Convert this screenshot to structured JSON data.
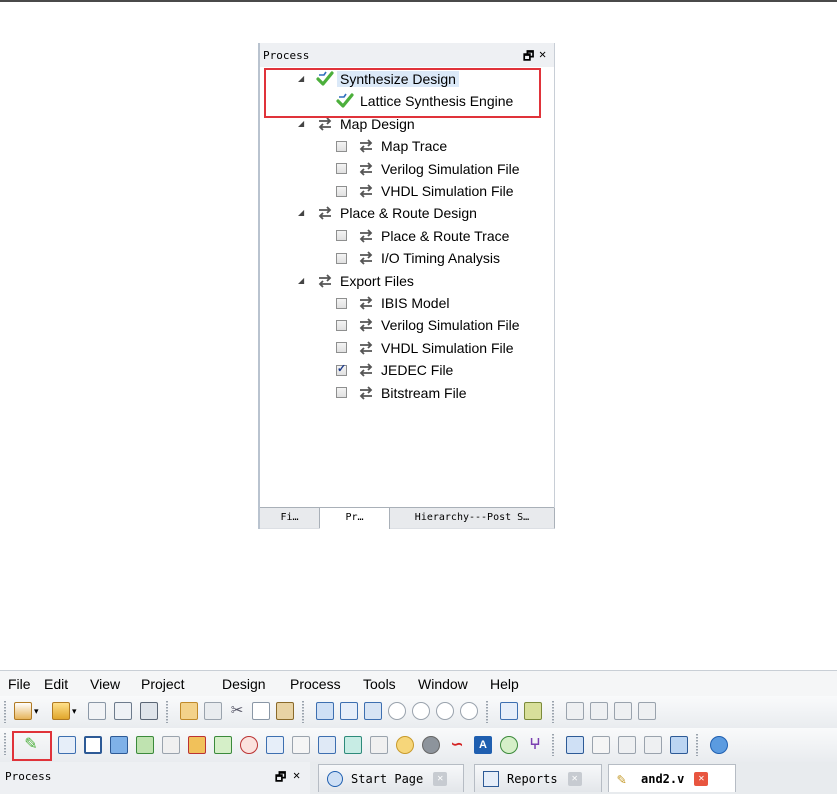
{
  "process_panel": {
    "title": "Process",
    "float_glyph": "🗗",
    "close_glyph": "✕",
    "tree": [
      {
        "label": "Synthesize Design",
        "level": 0,
        "icon": "check-run-icon",
        "selected": true
      },
      {
        "label": "Lattice Synthesis Engine",
        "level": 1,
        "icon": "check-run-icon"
      },
      {
        "label": "Map Design",
        "level": 0,
        "icon": "rerun-arrows-icon"
      },
      {
        "label": "Map Trace",
        "level": 1,
        "icon": "rerun-arrows-icon",
        "checked": false
      },
      {
        "label": "Verilog Simulation File",
        "level": 1,
        "icon": "rerun-arrows-icon",
        "checked": false
      },
      {
        "label": "VHDL Simulation File",
        "level": 1,
        "icon": "rerun-arrows-icon",
        "checked": false
      },
      {
        "label": "Place & Route Design",
        "level": 0,
        "icon": "rerun-arrows-icon"
      },
      {
        "label": "Place & Route Trace",
        "level": 1,
        "icon": "rerun-arrows-icon",
        "checked": false
      },
      {
        "label": "I/O Timing Analysis",
        "level": 1,
        "icon": "rerun-arrows-icon",
        "checked": false
      },
      {
        "label": "Export Files",
        "level": 0,
        "icon": "rerun-arrows-icon"
      },
      {
        "label": "IBIS Model",
        "level": 1,
        "icon": "rerun-arrows-icon",
        "checked": false
      },
      {
        "label": "Verilog Simulation File",
        "level": 1,
        "icon": "rerun-arrows-icon",
        "checked": false
      },
      {
        "label": "VHDL Simulation File",
        "level": 1,
        "icon": "rerun-arrows-icon",
        "checked": false
      },
      {
        "label": "JEDEC File",
        "level": 1,
        "icon": "rerun-arrows-icon",
        "checked": true
      },
      {
        "label": "Bitstream File",
        "level": 1,
        "icon": "rerun-arrows-icon",
        "checked": false
      }
    ],
    "tabs": [
      {
        "label": "Fi…",
        "active": false
      },
      {
        "label": "Pr…",
        "active": true
      },
      {
        "label": "Hierarchy---Post S…",
        "active": false
      }
    ]
  },
  "menubar": {
    "items": [
      "File",
      "Edit",
      "View",
      "Project",
      "Design",
      "Process",
      "Tools",
      "Window",
      "Help"
    ]
  },
  "bottom": {
    "process_title": "Process",
    "float_glyph": "🗗",
    "close_glyph": "✕",
    "tabs": [
      {
        "label": "Start Page",
        "icon": "start-page-icon",
        "active": false
      },
      {
        "label": "Reports",
        "icon": "reports-icon",
        "active": false
      },
      {
        "label": "and2.v",
        "icon": "edit-file-icon",
        "active": true
      }
    ]
  },
  "colors": {
    "highlight_box": "#e0333a",
    "selection": "#dbe9f8",
    "check_green": "#4caf3c",
    "arrow_gray": "#555555"
  }
}
